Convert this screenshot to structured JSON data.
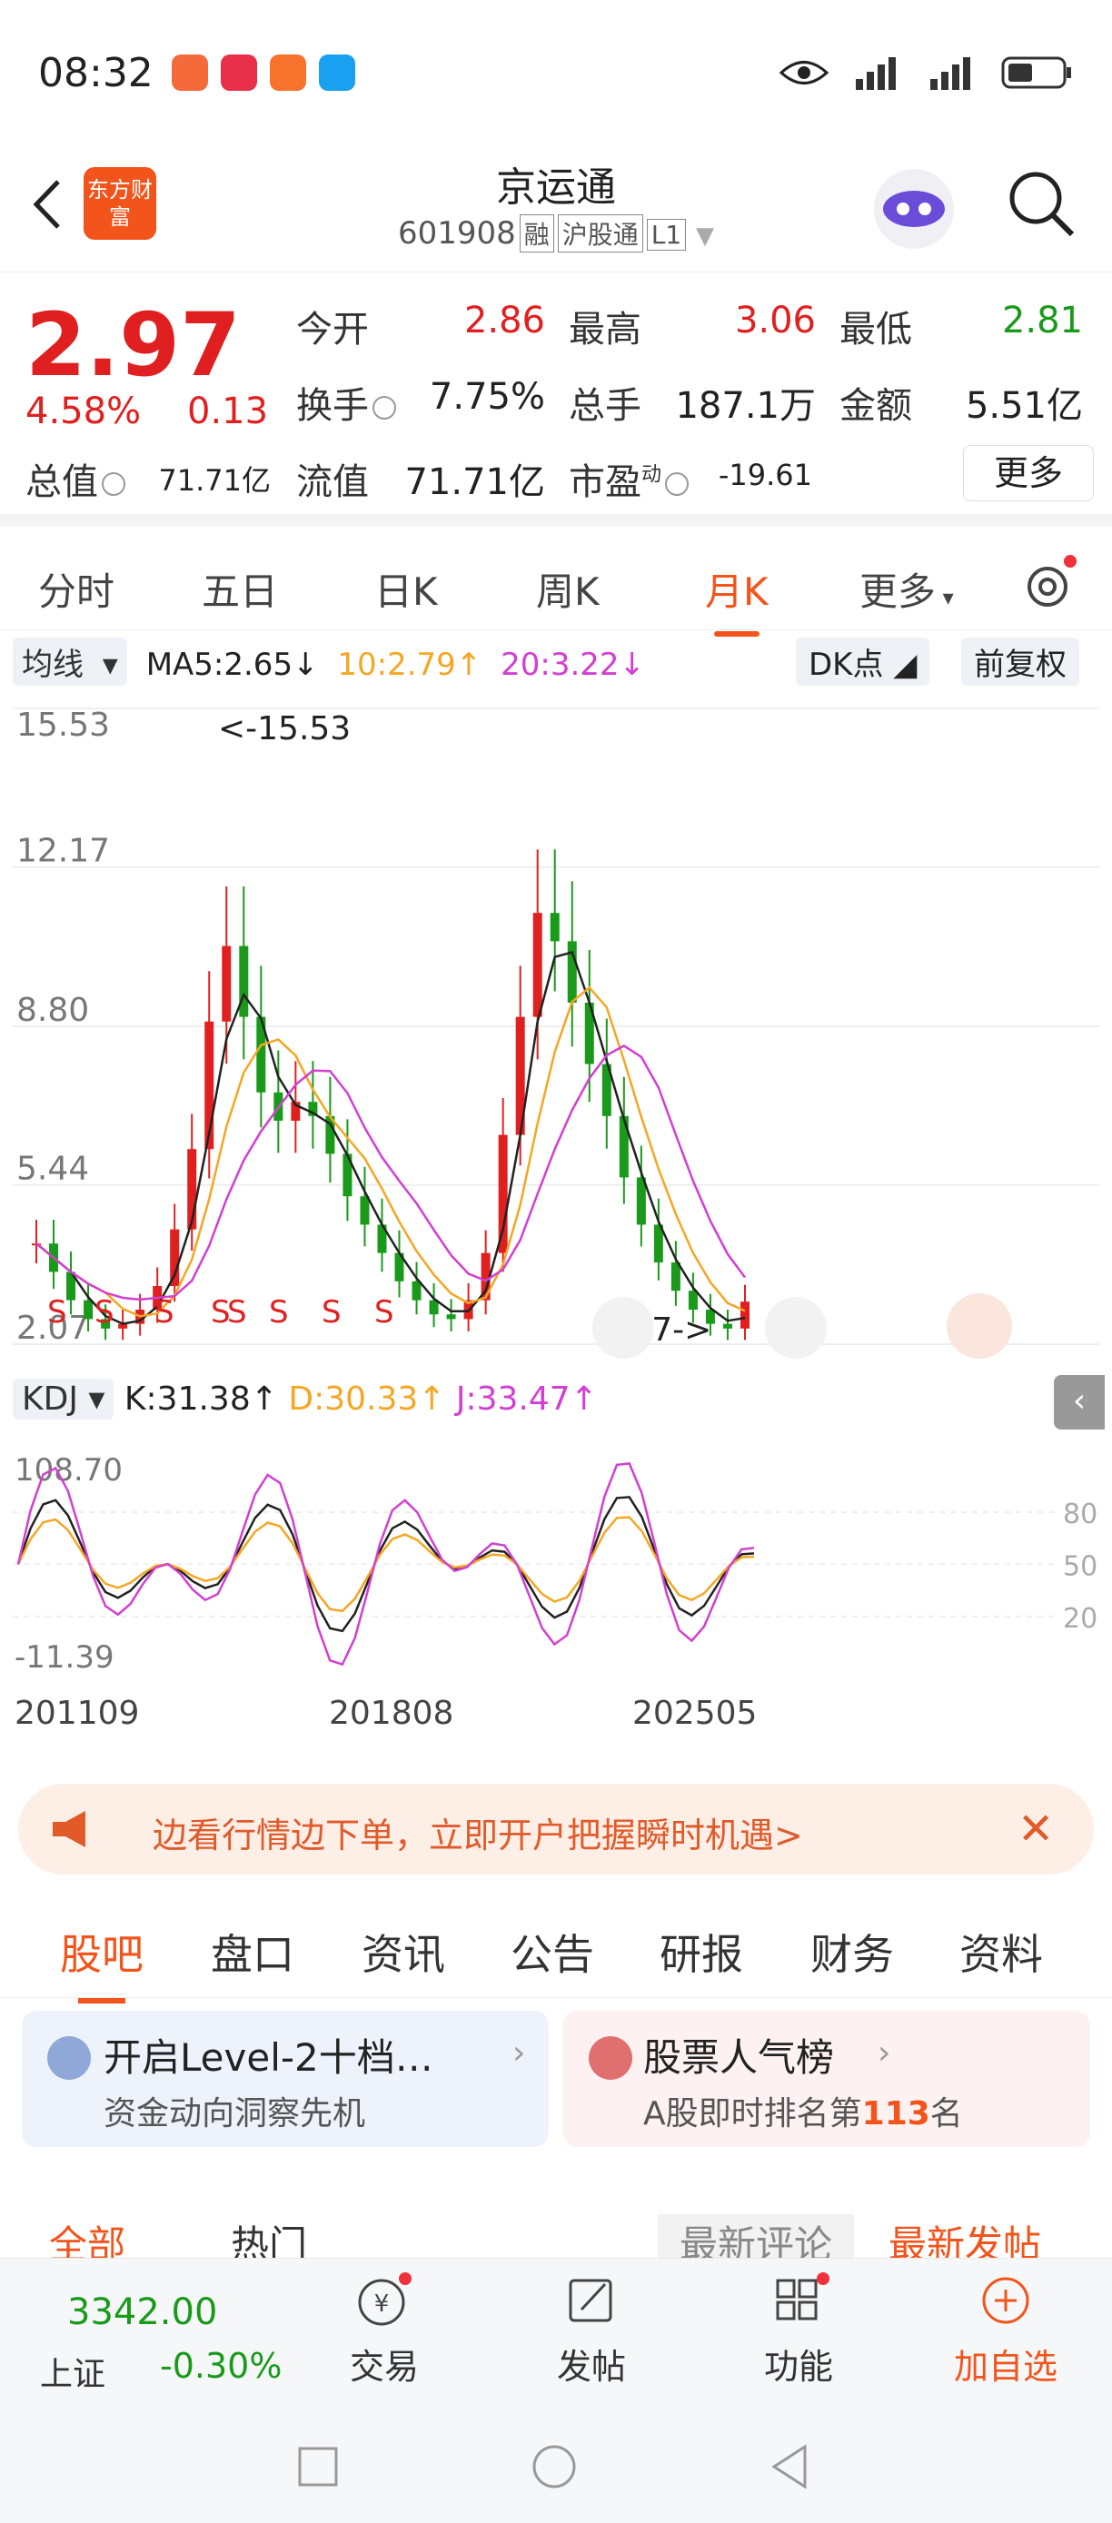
{
  "status_bar": {
    "time": "08:32"
  },
  "header": {
    "logo_text": "东方财富",
    "title": "京运通",
    "code": "601908",
    "tags": [
      "融",
      "沪股通",
      "L1"
    ]
  },
  "quote": {
    "price": "2.97",
    "change_pct": "4.58%",
    "change_abs": "0.13",
    "open_label": "今开",
    "open_val": "2.86",
    "high_label": "最高",
    "high_val": "3.06",
    "low_label": "最低",
    "low_val": "2.81",
    "turnover_label": "换手",
    "turnover_val": "7.75%",
    "volume_label": "总手",
    "volume_val": "187.1万",
    "amount_label": "金额",
    "amount_val": "5.51亿",
    "mktcap_label": "总值",
    "mktcap_val": "71.71亿",
    "float_label": "流值",
    "float_val": "71.71亿",
    "pe_label": "市盈",
    "pe_sup": "动",
    "pe_val": "-19.61",
    "more_label": "更多"
  },
  "period_tabs": [
    "分时",
    "五日",
    "日K",
    "周K",
    "月K",
    "更多"
  ],
  "chart_header": {
    "ma_selector": "均线",
    "ma5": "MA5:2.65↓",
    "ma10": "10:2.79↑",
    "ma20": "20:3.22↓",
    "dk_label": "DK点",
    "adjust_label": "前复权"
  },
  "kdj_header": {
    "selector": "KDJ",
    "k": "K:31.38↑",
    "d": "D:30.33↑",
    "j": "J:33.47↑"
  },
  "chart_data": [
    {
      "type": "candlestick",
      "title": "",
      "y_ticks": [
        "15.53",
        "12.17",
        "8.80",
        "5.44",
        "2.07"
      ],
      "ylim": [
        2.07,
        15.53
      ],
      "x_ticks": [
        "201109",
        "201808",
        "202505"
      ],
      "annotations": [
        "<-15.53",
        "2.07->"
      ],
      "signal_markers": [
        "S",
        "S",
        "S",
        "S",
        "S",
        "S",
        "S",
        "S"
      ],
      "series": [
        {
          "name": "MA5",
          "color": "#222222"
        },
        {
          "name": "10",
          "color": "#f5a623"
        },
        {
          "name": "20",
          "color": "#d23fd2"
        }
      ],
      "close_approx": [
        4.2,
        3.6,
        3.0,
        2.6,
        2.4,
        2.5,
        2.8,
        3.3,
        4.5,
        6.2,
        8.9,
        10.5,
        9.0,
        7.4,
        6.8,
        7.2,
        6.9,
        6.1,
        5.2,
        4.6,
        4.0,
        3.4,
        3.0,
        2.7,
        2.6,
        3.0,
        4.0,
        6.5,
        9.0,
        11.2,
        10.6,
        9.3,
        8.0,
        6.9,
        5.6,
        4.6,
        3.8,
        3.2,
        2.8,
        2.5,
        2.4,
        2.97
      ]
    },
    {
      "type": "line",
      "title": "KDJ",
      "y_ticks_left": [
        "108.70",
        "-11.39"
      ],
      "y_ticks_right": [
        "80",
        "50",
        "20"
      ],
      "ylim": [
        -11.39,
        108.7
      ],
      "series": [
        {
          "name": "K",
          "color": "#222222"
        },
        {
          "name": "D",
          "color": "#f5a623"
        },
        {
          "name": "J",
          "color": "#d23fd2"
        }
      ]
    }
  ],
  "promo": {
    "text": "边看行情边下单，立即开户把握瞬时机遇>"
  },
  "content_tabs": [
    "股吧",
    "盘口",
    "资讯",
    "公告",
    "研报",
    "财务",
    "资料"
  ],
  "cards": [
    {
      "title": "开启Level-2十档…",
      "sub": "资金动向洞察先机"
    },
    {
      "title": "股票人气榜",
      "sub_prefix": "A股即时排名第",
      "sub_rank": "113",
      "sub_suffix": "名"
    }
  ],
  "sort_bar": {
    "all": "全部",
    "hot": "热门",
    "latest_comment": "最新评论",
    "latest_post": "最新发帖"
  },
  "bottom_nav": {
    "index_value": "3342.00",
    "index_name": "上证",
    "index_change": "-0.30%",
    "items": [
      "交易",
      "发帖",
      "功能",
      "加自选"
    ]
  }
}
